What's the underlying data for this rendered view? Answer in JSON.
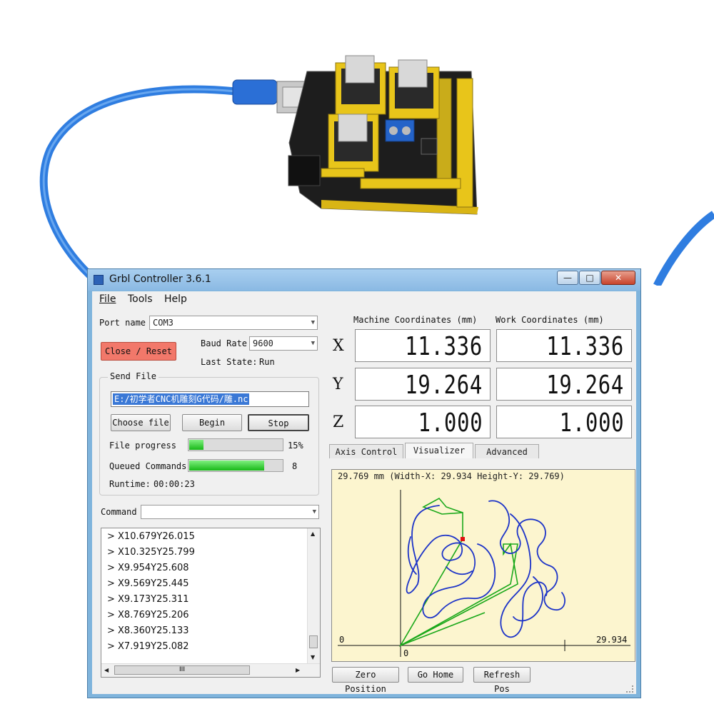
{
  "window": {
    "title": "Grbl Controller 3.6.1",
    "controls": {
      "minimize": "—",
      "maximize": "□",
      "close": "✕"
    }
  },
  "menu": {
    "items": [
      "File",
      "Tools",
      "Help"
    ]
  },
  "port": {
    "label": "Port name",
    "value": "COM3"
  },
  "close_reset_label": "Close / Reset",
  "baud": {
    "label": "Baud Rate",
    "value": "9600"
  },
  "last_state": {
    "label": "Last State:",
    "value": "Run"
  },
  "send_file": {
    "legend": "Send File",
    "path": "E:/初学者CNC机雕刻G代码/雕.nc",
    "choose_label": "Choose file",
    "begin_label": "Begin",
    "stop_label": "Stop"
  },
  "file_progress": {
    "label": "File progress",
    "value_text": "15%",
    "fraction": 0.15
  },
  "queued": {
    "label": "Queued Commands",
    "value_text": "8",
    "fraction": 0.81
  },
  "runtime": {
    "label": "Runtime:",
    "value": "00:00:23"
  },
  "command": {
    "label": "Command",
    "value": ""
  },
  "log": [
    "> X10.679Y26.015",
    "> X10.325Y25.799",
    "> X9.954Y25.608",
    "> X9.569Y25.445",
    "> X9.173Y25.311",
    "> X8.769Y25.206",
    "> X8.360Y25.133",
    "> X7.919Y25.082"
  ],
  "hscroll_thumb": "III",
  "coords": {
    "machine_header": "Machine Coordinates (mm)",
    "work_header": "Work Coordinates (mm)",
    "axes": [
      "X",
      "Y",
      "Z"
    ],
    "machine": [
      "11.336",
      "19.264",
      "1.000"
    ],
    "work": [
      "11.336",
      "19.264",
      "1.000"
    ]
  },
  "tabs": [
    "Axis Control",
    "Visualizer",
    "Advanced"
  ],
  "active_tab": "Visualizer",
  "visualizer": {
    "header": "29.769 mm  (Width-X: 29.934  Height-Y: 29.769)",
    "x_min_label": "0",
    "x_max_label": "29.934",
    "y_origin_label": "0",
    "path_color": "#1c33c8",
    "rapid_color": "#1aa81a",
    "tool_color": "#e01010",
    "background": "#fcf5cf"
  },
  "bottom_buttons": [
    "Zero Position",
    "Go Home",
    "Refresh Pos"
  ],
  "colors": {
    "close_reset_bg": "#f2786a",
    "progress_green": "#18b818",
    "title_bar": "#8ab9e3"
  }
}
